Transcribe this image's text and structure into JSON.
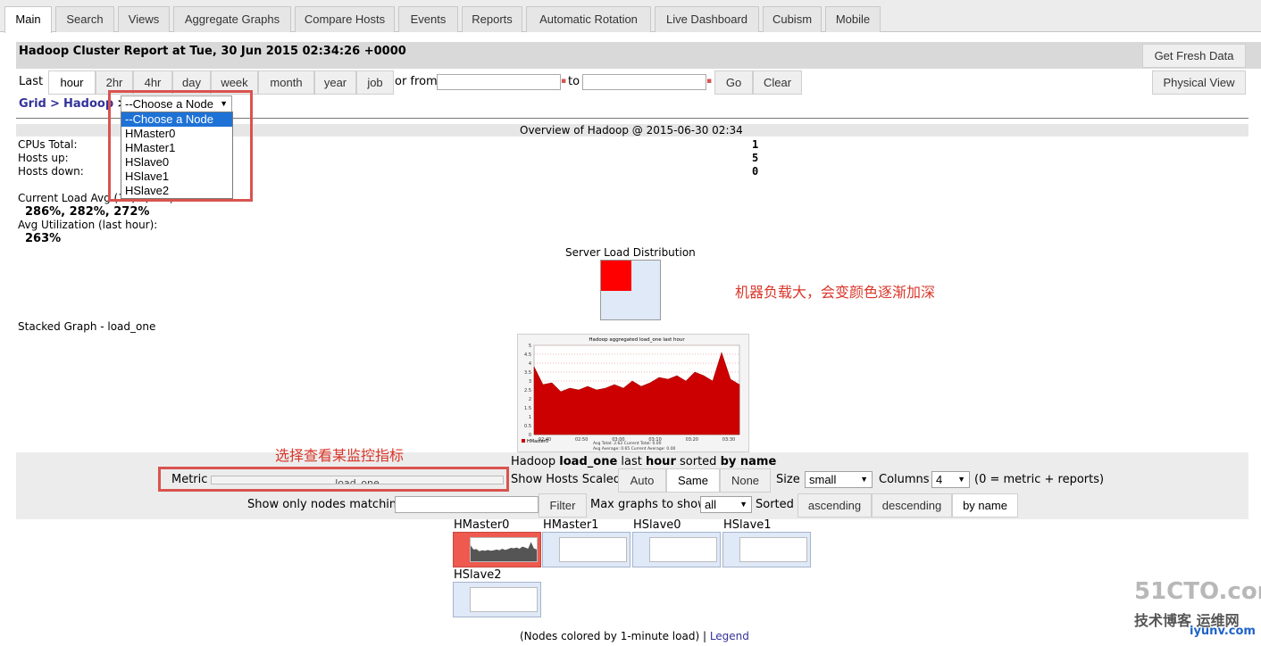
{
  "tabs": [
    "Main",
    "Search",
    "Views",
    "Aggregate Graphs",
    "Compare Hosts",
    "Events",
    "Reports",
    "Automatic Rotation",
    "Live Dashboard",
    "Cubism",
    "Mobile"
  ],
  "header": {
    "title": "Hadoop Cluster Report at Tue, 30 Jun 2015 02:34:26 +0000",
    "fresh_button": "Get Fresh Data",
    "physical_view_button": "Physical View"
  },
  "range": {
    "last_label": "Last",
    "options": [
      "hour",
      "2hr",
      "4hr",
      "day",
      "week",
      "month",
      "year",
      "job"
    ],
    "selected": "hour",
    "or_from_label": "or from",
    "to_label": "to",
    "go_button": "Go",
    "clear_button": "Clear"
  },
  "breadcrumb": {
    "grid": "Grid",
    "sep1": ">",
    "cluster": "Hadoop",
    "sep2": ">"
  },
  "node_select": {
    "value": "--Choose a Node",
    "options": [
      "--Choose a Node",
      "HMaster0",
      "HMaster1",
      "HSlave0",
      "HSlave1",
      "HSlave2"
    ]
  },
  "overview": {
    "title": "Overview of Hadoop @ 2015-06-30 02:34",
    "cpus_label": "CPUs Total:",
    "cpus_value": "1",
    "hosts_up_label": "Hosts up:",
    "hosts_up_value": "5",
    "hosts_down_label": "Hosts down:",
    "hosts_down_value": "0",
    "load_label": "Current Load Avg (15, 5, 1m):",
    "load_value": "286%, 282%, 272%",
    "util_label": "Avg Utilization (last hour):",
    "util_value": "263%"
  },
  "server_load": {
    "title": "Server Load Distribution",
    "annotation": "机器负载大，会变颜色逐渐加深"
  },
  "stacked": {
    "label": "Stacked Graph - load_one",
    "graph_title": "Hadoop aggregated load_one last hour",
    "legend_host": "HMaster0",
    "stats_line1": "Avg Total:  2.62  Current Total:  0.00",
    "stats_line2": "Avg Average:  0.65  Current Average:  0.00",
    "x_ticks": [
      "02:40",
      "02:50",
      "03:00",
      "03:10",
      "03:20",
      "03:30"
    ],
    "y_ticks": [
      "5",
      "4.5",
      "4",
      "3.5",
      "3",
      "2.5",
      "2",
      "1.5",
      "1",
      "0.5",
      "0"
    ]
  },
  "metric_bar": {
    "heading_prefix": "Hadoop",
    "heading_metric": "load_one",
    "heading_mid": "last",
    "heading_range": "hour",
    "heading_sorted": "sorted",
    "heading_sort": "by name",
    "annotation": "选择查看某监控指标",
    "metric_label": "Metric",
    "metric_value": "load_one",
    "scaled_label": "Show Hosts Scaled:",
    "scaled_options": [
      "Auto",
      "Same",
      "None"
    ],
    "scaled_selected": "Same",
    "size_label": "Size",
    "size_value": "small",
    "columns_label": "Columns",
    "columns_value": "4",
    "columns_hint": "(0 = metric + reports)",
    "filter_label": "Show only nodes matching",
    "filter_button": "Filter",
    "max_label": "Max graphs to show",
    "max_value": "all",
    "sorted_label": "Sorted",
    "sort_options": [
      "ascending",
      "descending",
      "by name"
    ],
    "sort_selected": "by name"
  },
  "hosts": [
    {
      "name": "HMaster0"
    },
    {
      "name": "HMaster1"
    },
    {
      "name": "HSlave0"
    },
    {
      "name": "HSlave1"
    },
    {
      "name": "HSlave2"
    }
  ],
  "footer": {
    "text": "(Nodes colored by 1-minute load) |",
    "legend_link": "Legend"
  },
  "watermark": {
    "line1": "51CTO.com",
    "line2": "技术博客 运维网",
    "line3": "iyunv.com"
  },
  "colors": {
    "hot_node": "#ff0000",
    "load_fill": "#cc0000",
    "annotation": "#d9362a"
  },
  "chart_data": {
    "type": "area",
    "title": "Hadoop aggregated load_one last hour",
    "xlabel": "",
    "ylabel": "",
    "ylim": [
      0,
      5
    ],
    "x": [
      "02:40",
      "02:50",
      "03:00",
      "03:10",
      "03:20",
      "03:30"
    ],
    "series": [
      {
        "name": "HMaster0",
        "values": [
          3.8,
          2.8,
          2.9,
          2.4,
          2.6,
          2.5,
          2.7,
          2.5,
          2.6,
          2.8,
          2.6,
          3.0,
          2.7,
          2.9,
          3.2,
          3.1,
          3.3,
          3.0,
          3.5,
          3.3,
          3.0,
          4.6,
          3.1,
          2.8
        ]
      }
    ]
  }
}
